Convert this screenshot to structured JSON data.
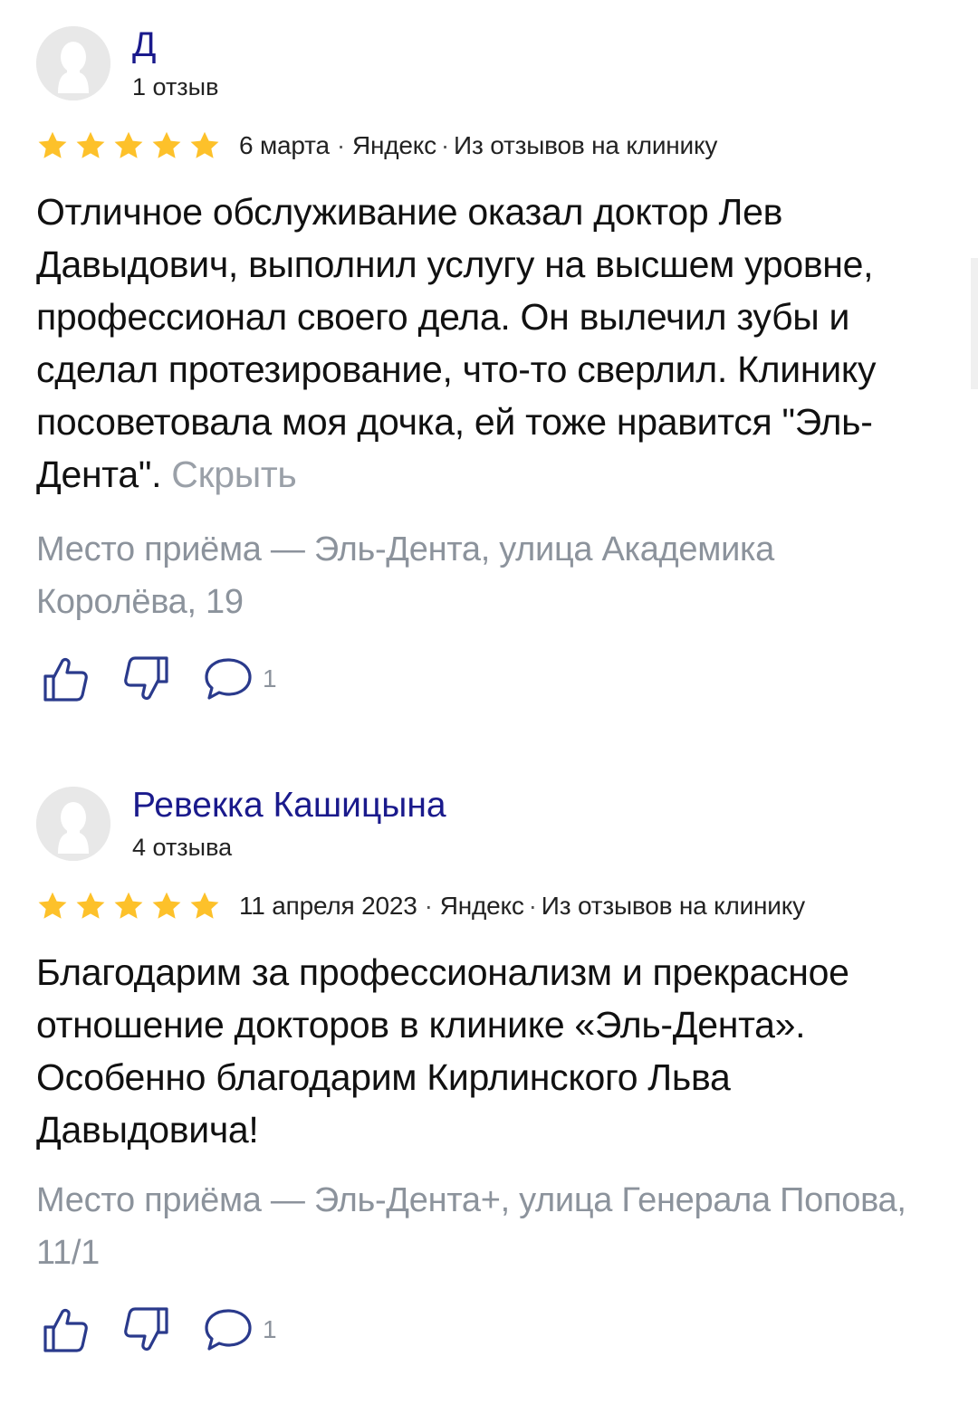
{
  "reviews": [
    {
      "author": "Д",
      "review_count": "1 отзыв",
      "rating": 5,
      "date": "6 марта",
      "source": "Яндекс",
      "origin": "Из отзывов на клинику",
      "text": "Отличное обслуживание оказал доктор Лев Давыдович, выполнил услугу на высшем уровне, профессионал своего дела. Он вылечил зубы и сделал протезирование, что-то сверлил. Клинику посоветовала моя дочка, ей тоже нравится \"Эль-Дента\".",
      "hide_label": "Скрыть",
      "place": "Место приёма — Эль-Дента, улица Академика Королёва, 19",
      "comments": "1"
    },
    {
      "author": "Ревекка Кашицына",
      "review_count": "4 отзыва",
      "rating": 5,
      "date": "11 апреля 2023",
      "source": "Яндекс",
      "origin": "Из отзывов на клинику",
      "text": "Благодарим за профессионализм и прекрасное отношение докторов в клинике «Эль-Дента». Особенно благодарим Кирлинского Льва Давыдовича!",
      "hide_label": "",
      "place": "Место приёма — Эль-Дента+, улица Генерала Попова, 11/1",
      "comments": "1"
    }
  ],
  "separator": "·",
  "colors": {
    "author": "#1a1a8c",
    "star": "#fdc12a",
    "muted": "#8c939c",
    "hide_link": "#9aa0a8"
  },
  "icons": {
    "like": "thumbs-up-icon",
    "dislike": "thumbs-down-icon",
    "comment": "comment-bubble-icon",
    "star": "star-icon",
    "avatar": "default-avatar-icon"
  }
}
